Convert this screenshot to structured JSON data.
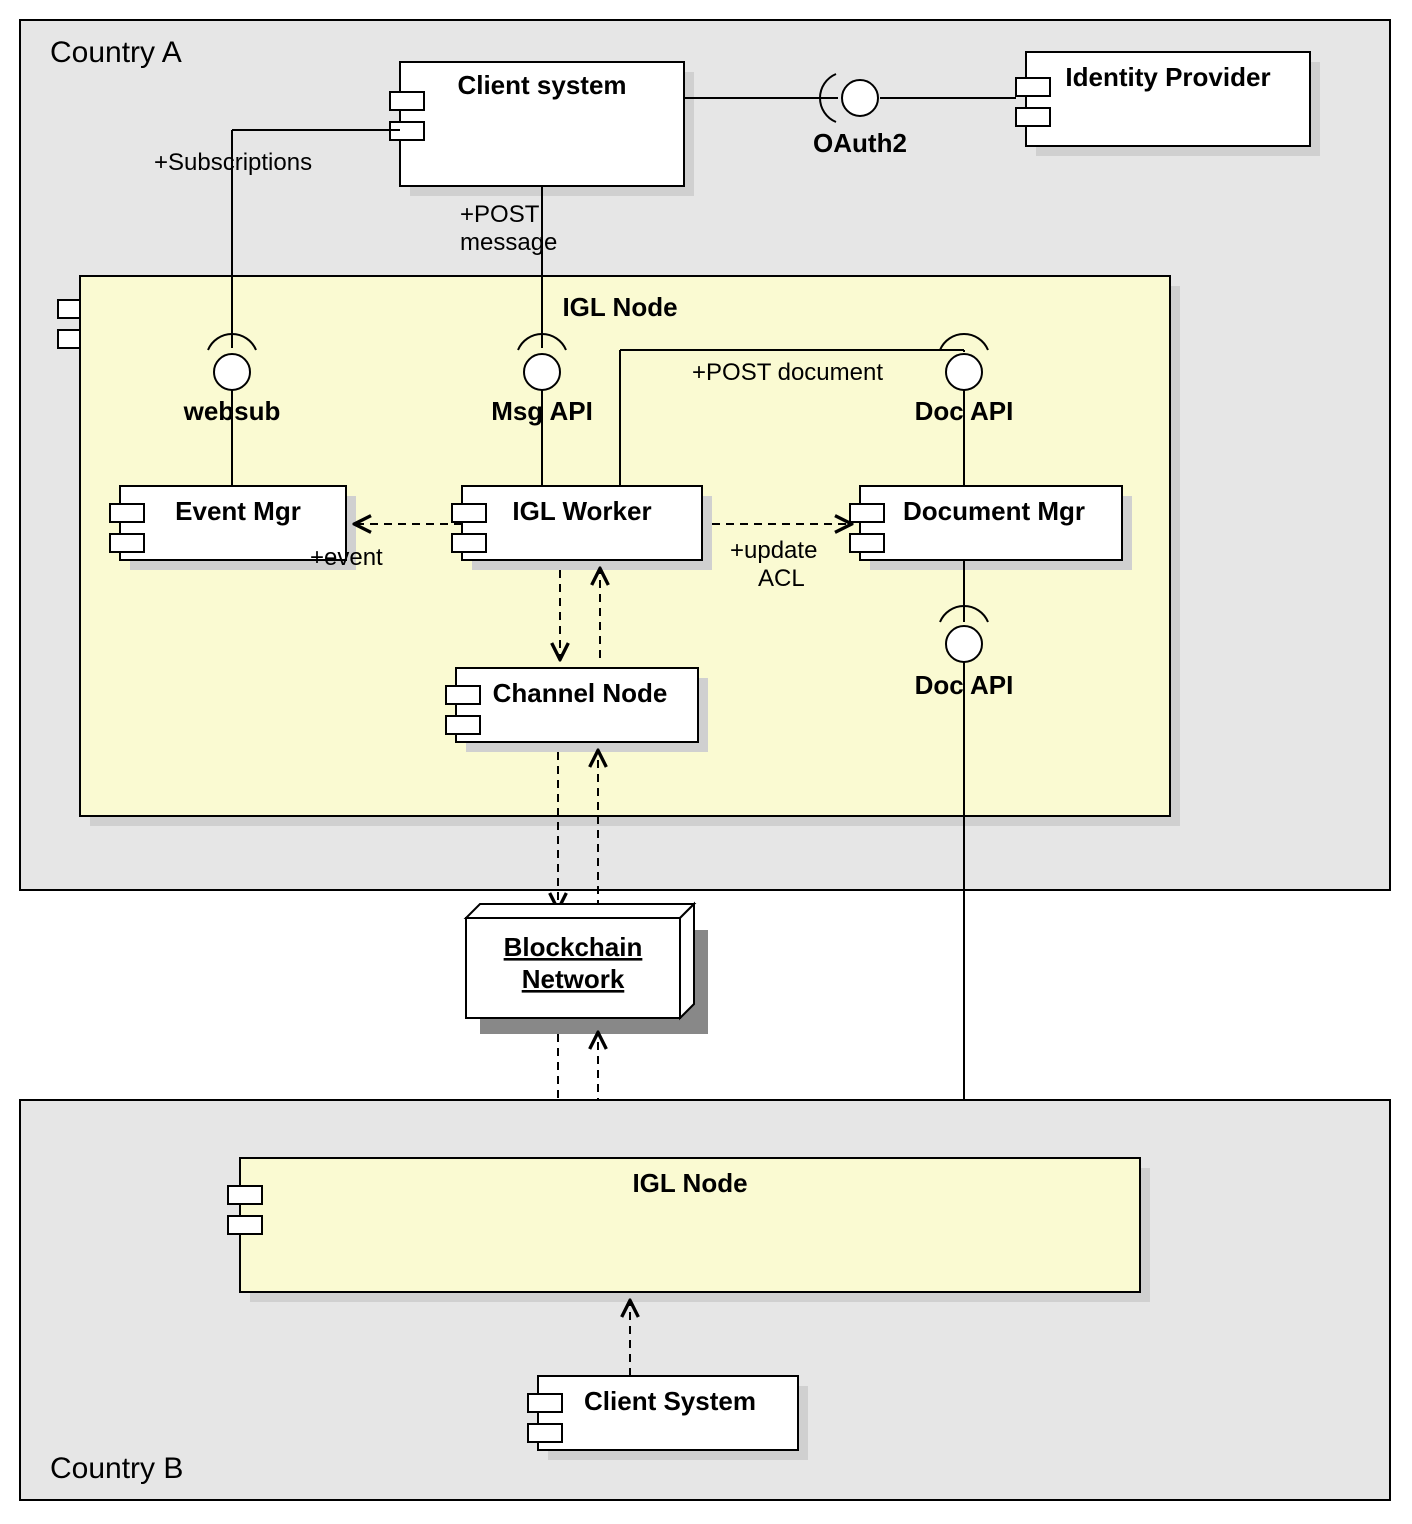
{
  "diagram": {
    "type": "uml-component",
    "countries": {
      "a": {
        "label": "Country A"
      },
      "b": {
        "label": "Country B"
      }
    },
    "components": {
      "client_system_a": {
        "label": "Client system"
      },
      "identity_provider": {
        "label": "Identity Provider"
      },
      "igl_node_a": {
        "label": "IGL Node"
      },
      "event_mgr": {
        "label": "Event Mgr"
      },
      "igl_worker": {
        "label": "IGL Worker"
      },
      "document_mgr": {
        "label": "Document Mgr"
      },
      "channel_node": {
        "label": "Channel Node"
      },
      "blockchain": {
        "line1": "Blockchain",
        "line2": "Network"
      },
      "igl_node_b": {
        "label": "IGL Node"
      },
      "client_system_b": {
        "label": "Client System"
      }
    },
    "interfaces": {
      "oauth2": {
        "label": "OAuth2"
      },
      "websub": {
        "label": "websub"
      },
      "msg_api": {
        "label": "Msg API"
      },
      "doc_api_top": {
        "label": "Doc API"
      },
      "doc_api_bottom": {
        "label": "Doc API"
      }
    },
    "edges": {
      "subscriptions": {
        "label": "+Subscriptions"
      },
      "post_message": {
        "line1": "+POST",
        "line2": "message"
      },
      "post_document": {
        "label": "+POST document"
      },
      "event": {
        "label": "+event"
      },
      "update_acl": {
        "line1": "+update",
        "line2": "ACL"
      }
    }
  }
}
